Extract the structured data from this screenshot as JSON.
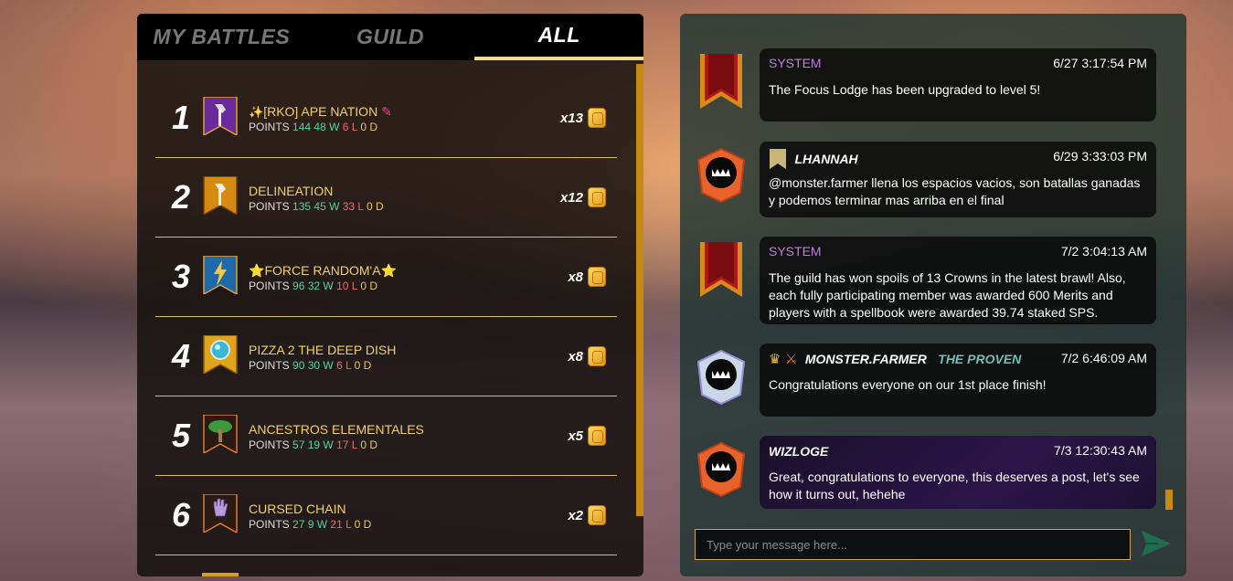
{
  "tabs": [
    {
      "label": "MY BATTLES"
    },
    {
      "label": "GUILD"
    },
    {
      "label": "ALL"
    }
  ],
  "leaderboard": [
    {
      "rank": "1",
      "name": "[RKO] APE NATION",
      "points_label": "POINTS",
      "points": "144",
      "wins": "48 W",
      "losses": "6 L",
      "draws": "0 D",
      "multiplier": "x13",
      "banner_color": "#6a2a9a",
      "icon": "axe-icon"
    },
    {
      "rank": "2",
      "name": "DELINEATION",
      "points_label": "POINTS",
      "points": "135",
      "wins": "45 W",
      "losses": "33 L",
      "draws": "0 D",
      "multiplier": "x12",
      "banner_color": "#d58a12",
      "icon": "axe-icon"
    },
    {
      "rank": "3",
      "name": "FORCE RANDOM'A",
      "points_label": "POINTS",
      "points": "96",
      "wins": "32 W",
      "losses": "10 L",
      "draws": "0 D",
      "multiplier": "x8",
      "banner_color": "#1e6aa8",
      "icon": "lightning-icon"
    },
    {
      "rank": "4",
      "name": "PIZZA 2 THE DEEP DISH",
      "points_label": "POINTS",
      "points": "90",
      "wins": "30 W",
      "losses": "6 L",
      "draws": "0 D",
      "multiplier": "x8",
      "banner_color": "#e0a51a",
      "icon": "orb-icon"
    },
    {
      "rank": "5",
      "name": "ANCESTROS ELEMENTALES",
      "points_label": "POINTS",
      "points": "57",
      "wins": "19 W",
      "losses": "17 L",
      "draws": "0 D",
      "multiplier": "x5",
      "banner_color": "#2a1a14",
      "icon": "tree-icon"
    },
    {
      "rank": "6",
      "name": "CURSED CHAIN",
      "points_label": "POINTS",
      "points": "27",
      "wins": "9 W",
      "losses": "21 L",
      "draws": "0 D",
      "multiplier": "x2",
      "banner_color": "#2a1a14",
      "icon": "hand-icon"
    }
  ],
  "chat": {
    "messages": [
      {
        "sender": "SYSTEM",
        "time": "6/27 3:17:54 PM",
        "text": "The Focus Lodge has been upgraded to level 5!"
      },
      {
        "sender": "LHANNAH",
        "time": "6/29 3:33:03 PM",
        "text": "@monster.farmer llena los espacios vacios, son batallas ganadas y podemos terminar mas arriba en el final"
      },
      {
        "sender": "SYSTEM",
        "time": "7/2 3:04:13 AM",
        "text": "The guild has won spoils of 13 Crowns in the latest brawl! Also, each fully participating member was awarded 600 Merits and players with a spellbook were awarded 39.74 staked SPS."
      },
      {
        "sender": "MONSTER.FARMER",
        "title": "THE PROVEN",
        "time": "7/2 6:46:09 AM",
        "text": "Congratulations everyone on our 1st place finish!"
      },
      {
        "sender": "WIZLOGE",
        "time": "7/3 12:30:43 AM",
        "text": "Great, congratulations to everyone, this deserves a post, let's see how it turns out, hehehe"
      }
    ],
    "input_placeholder": "Type your message here..."
  }
}
